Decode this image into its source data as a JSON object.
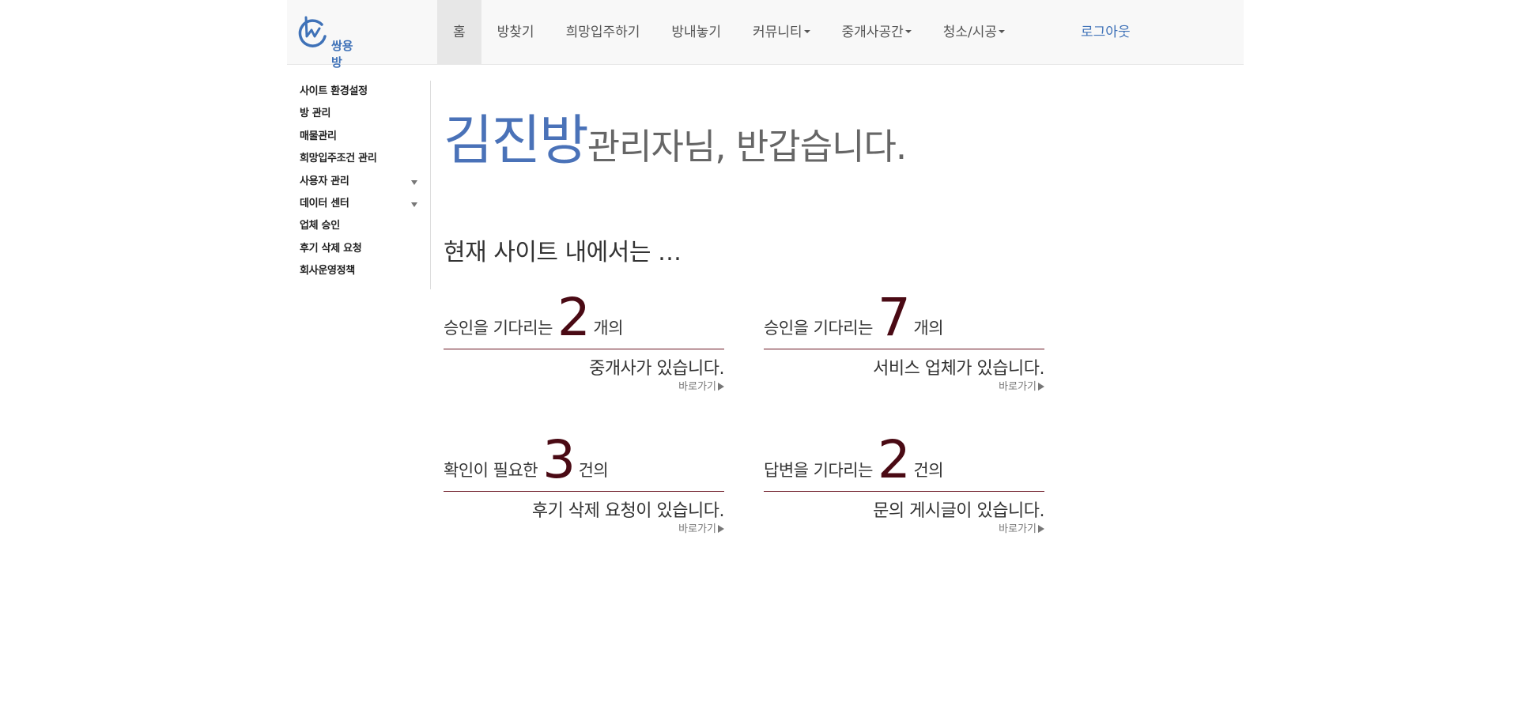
{
  "brand": {
    "name": "쌍용방",
    "logo_icon": "house-circle-logo",
    "accent_color": "#3f72b8"
  },
  "nav": {
    "items": [
      {
        "label": "홈",
        "active": true,
        "dropdown": false
      },
      {
        "label": "방찾기",
        "active": false,
        "dropdown": false
      },
      {
        "label": "희망입주하기",
        "active": false,
        "dropdown": false
      },
      {
        "label": "방내놓기",
        "active": false,
        "dropdown": false
      },
      {
        "label": "커뮤니티",
        "active": false,
        "dropdown": true
      },
      {
        "label": "중개사공간",
        "active": false,
        "dropdown": true
      },
      {
        "label": "청소/시공",
        "active": false,
        "dropdown": true
      }
    ],
    "logout": "로그아웃"
  },
  "sidebar": {
    "items": [
      {
        "label": "사이트 환경설정",
        "expandable": false
      },
      {
        "label": "방 관리",
        "expandable": false
      },
      {
        "label": "매물관리",
        "expandable": false
      },
      {
        "label": "희망입주조건 관리",
        "expandable": false
      },
      {
        "label": "사용자 관리",
        "expandable": true
      },
      {
        "label": "데이터 센터",
        "expandable": true
      },
      {
        "label": "업체 승인",
        "expandable": false
      },
      {
        "label": "후기 삭제 요청",
        "expandable": false
      },
      {
        "label": "회사운영정책",
        "expandable": false
      }
    ]
  },
  "greeting": {
    "name": "김진방",
    "rest": "관리자님, 반갑습니다."
  },
  "subtitle": "현재 사이트 내에서는 …",
  "cards": [
    {
      "prefix": "승인을 기다리는",
      "count": "2",
      "suffix": "개의",
      "body": "중개사가 있습니다.",
      "link": "바로가기"
    },
    {
      "prefix": "승인을 기다리는",
      "count": "7",
      "suffix": "개의",
      "body": "서비스 업체가 있습니다.",
      "link": "바로가기"
    },
    {
      "prefix": "확인이 필요한",
      "count": "3",
      "suffix": "건의",
      "body": "후기 삭제 요청이 있습니다.",
      "link": "바로가기"
    },
    {
      "prefix": "답변을 기다리는",
      "count": "2",
      "suffix": "건의",
      "body": "문의 게시글이 있습니다.",
      "link": "바로가기"
    }
  ],
  "colors": {
    "count": "#4a0a14",
    "rule": "#6b1622",
    "greeting_name": "#4a72b8"
  }
}
